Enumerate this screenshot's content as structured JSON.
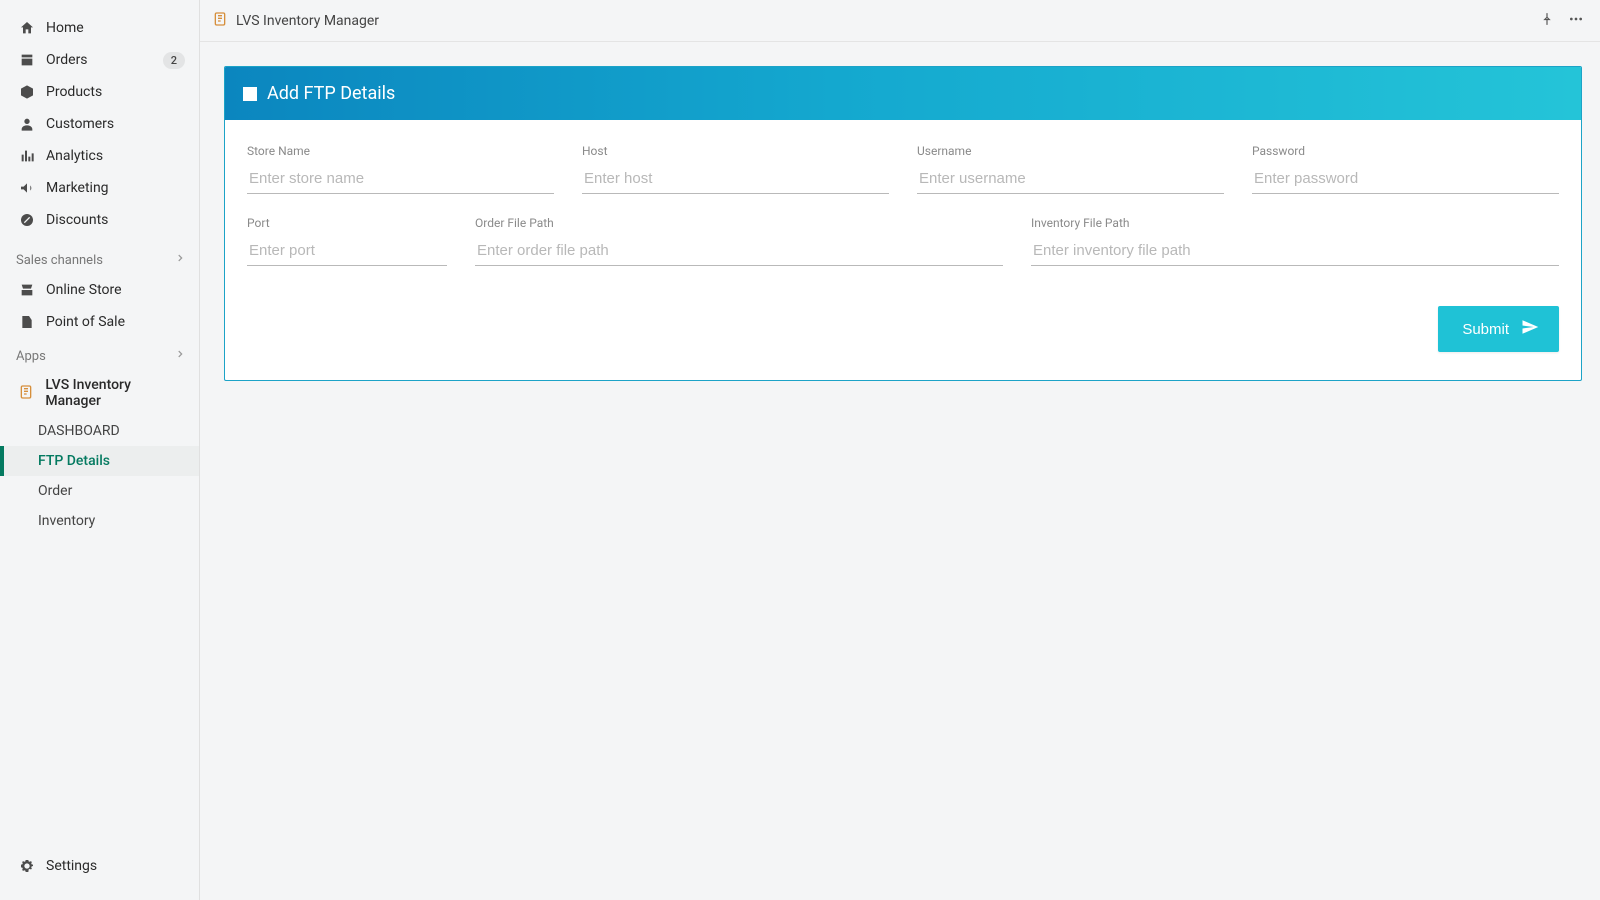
{
  "sidebar": {
    "main_nav": [
      {
        "label": "Home"
      },
      {
        "label": "Orders",
        "badge": "2"
      },
      {
        "label": "Products"
      },
      {
        "label": "Customers"
      },
      {
        "label": "Analytics"
      },
      {
        "label": "Marketing"
      },
      {
        "label": "Discounts"
      }
    ],
    "sales_header": "Sales channels",
    "sales_items": [
      {
        "label": "Online Store"
      },
      {
        "label": "Point of Sale"
      }
    ],
    "apps_header": "Apps",
    "app_name": "LVS Inventory Manager",
    "app_subitems": [
      {
        "label": "DASHBOARD"
      },
      {
        "label": "FTP Details"
      },
      {
        "label": "Order"
      },
      {
        "label": "Inventory"
      }
    ],
    "settings_label": "Settings"
  },
  "topbar": {
    "title": "LVS Inventory Manager"
  },
  "card": {
    "title": "Add FTP Details",
    "fields": {
      "store_name": {
        "label": "Store Name",
        "placeholder": "Enter store name"
      },
      "host": {
        "label": "Host",
        "placeholder": "Enter host"
      },
      "username": {
        "label": "Username",
        "placeholder": "Enter username"
      },
      "password": {
        "label": "Password",
        "placeholder": "Enter password"
      },
      "port": {
        "label": "Port",
        "placeholder": "Enter port"
      },
      "order_path": {
        "label": "Order File Path",
        "placeholder": "Enter order file path"
      },
      "inventory_path": {
        "label": "Inventory File Path",
        "placeholder": "Enter inventory file path"
      }
    },
    "submit_label": "Submit"
  }
}
